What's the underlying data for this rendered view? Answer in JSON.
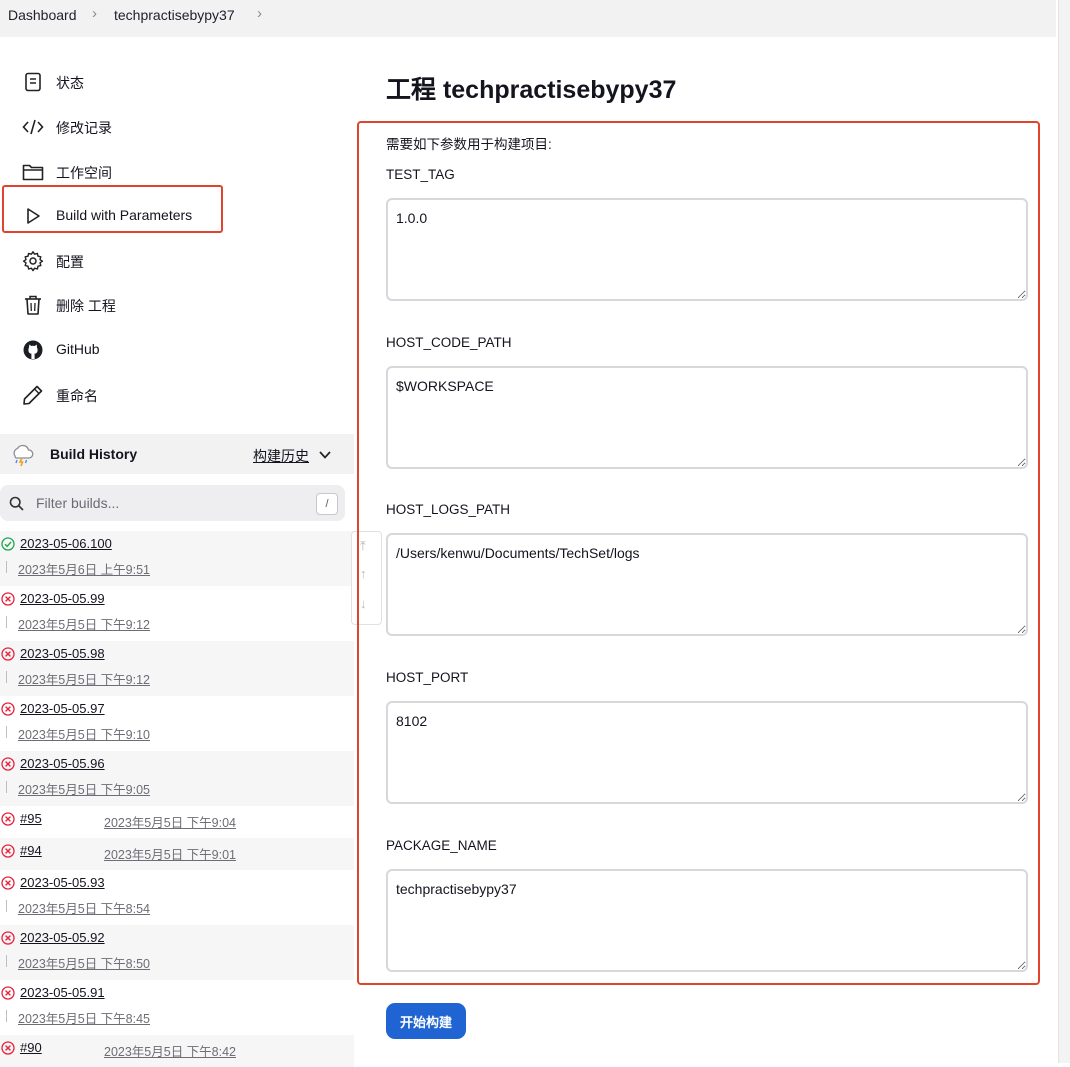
{
  "breadcrumb": {
    "items": [
      "Dashboard",
      "techpractisebypy37"
    ]
  },
  "sidebar": {
    "items": [
      {
        "label": "状态",
        "icon": "document-icon"
      },
      {
        "label": "修改记录",
        "icon": "code-icon"
      },
      {
        "label": "工作空间",
        "icon": "folder-icon"
      },
      {
        "label": "Build with Parameters",
        "icon": "play-icon"
      },
      {
        "label": "配置",
        "icon": "gear-icon"
      },
      {
        "label": "删除 工程",
        "icon": "trash-icon"
      },
      {
        "label": "GitHub",
        "icon": "github-icon"
      },
      {
        "label": "重命名",
        "icon": "pencil-icon"
      }
    ]
  },
  "build_history": {
    "title": "Build History",
    "trend_label": "构建历史",
    "filter_placeholder": "Filter builds...",
    "filter_shortcut": "/",
    "builds": [
      {
        "name": "2023-05-06.100",
        "date": "2023年5月6日 上午9:51",
        "status": "success"
      },
      {
        "name": "2023-05-05.99",
        "date": "2023年5月5日 下午9:12",
        "status": "failed"
      },
      {
        "name": "2023-05-05.98",
        "date": "2023年5月5日 下午9:12",
        "status": "failed"
      },
      {
        "name": "2023-05-05.97",
        "date": "2023年5月5日 下午9:10",
        "status": "failed"
      },
      {
        "name": "2023-05-05.96",
        "date": "2023年5月5日 下午9:05",
        "status": "failed"
      },
      {
        "name": "#95",
        "date": "2023年5月5日 下午9:04",
        "status": "failed"
      },
      {
        "name": "#94",
        "date": "2023年5月5日 下午9:01",
        "status": "failed"
      },
      {
        "name": "2023-05-05.93",
        "date": "2023年5月5日 下午8:54",
        "status": "failed"
      },
      {
        "name": "2023-05-05.92",
        "date": "2023年5月5日 下午8:50",
        "status": "failed"
      },
      {
        "name": "2023-05-05.91",
        "date": "2023年5月5日 下午8:45",
        "status": "failed"
      },
      {
        "name": "#90",
        "date": "2023年5月5日 下午8:42",
        "status": "failed"
      }
    ]
  },
  "main": {
    "title": "工程 techpractisebypy37",
    "intro": "需要如下参数用于构建项目:",
    "params": [
      {
        "label": "TEST_TAG",
        "value": "1.0.0"
      },
      {
        "label": "HOST_CODE_PATH",
        "value": "$WORKSPACE"
      },
      {
        "label": "HOST_LOGS_PATH",
        "value": "/Users/kenwu/Documents/TechSet/logs"
      },
      {
        "label": "HOST_PORT",
        "value": "8102"
      },
      {
        "label": "PACKAGE_NAME",
        "value": "techpractisebypy37"
      }
    ],
    "build_button": "开始构建"
  },
  "colors": {
    "highlight": "#e0442d",
    "primary_button": "#1f64d2",
    "success": "#1ea64b",
    "failure": "#e6233e"
  }
}
